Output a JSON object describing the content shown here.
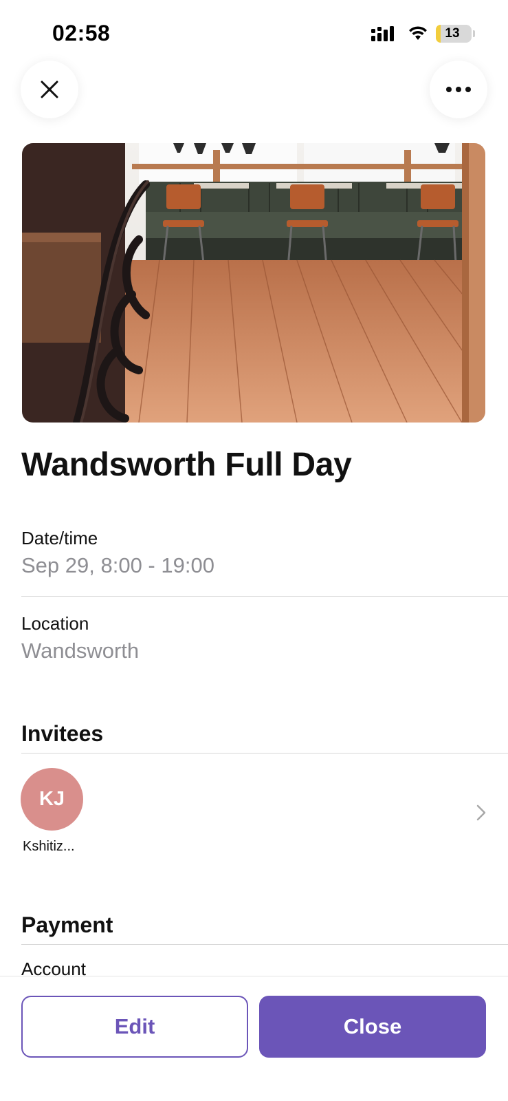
{
  "status_bar": {
    "time": "02:58",
    "battery_level": "13",
    "icons": [
      "cellular-signal-icon",
      "wifi-icon",
      "battery-icon"
    ]
  },
  "header": {
    "close_icon": "close-icon",
    "more_icon": "more-options-icon"
  },
  "hero_image": {
    "subject": "cafe-interior-photo"
  },
  "event": {
    "title": "Wandsworth Full Day"
  },
  "details": {
    "datetime_label": "Date/time",
    "datetime_value": "Sep 29, 8:00 - 19:00",
    "location_label": "Location",
    "location_value": "Wandsworth"
  },
  "invitees": {
    "title": "Invitees",
    "people": [
      {
        "initials": "KJ",
        "name": "Kshitiz..."
      }
    ]
  },
  "payment": {
    "title": "Payment",
    "account_label": "Account"
  },
  "actions": {
    "edit_label": "Edit",
    "close_label": "Close"
  },
  "colors": {
    "accent": "#6b55b8",
    "avatar_bg": "#d98f8c",
    "secondary_text": "#8e8e93",
    "divider": "#d6d6d6"
  }
}
